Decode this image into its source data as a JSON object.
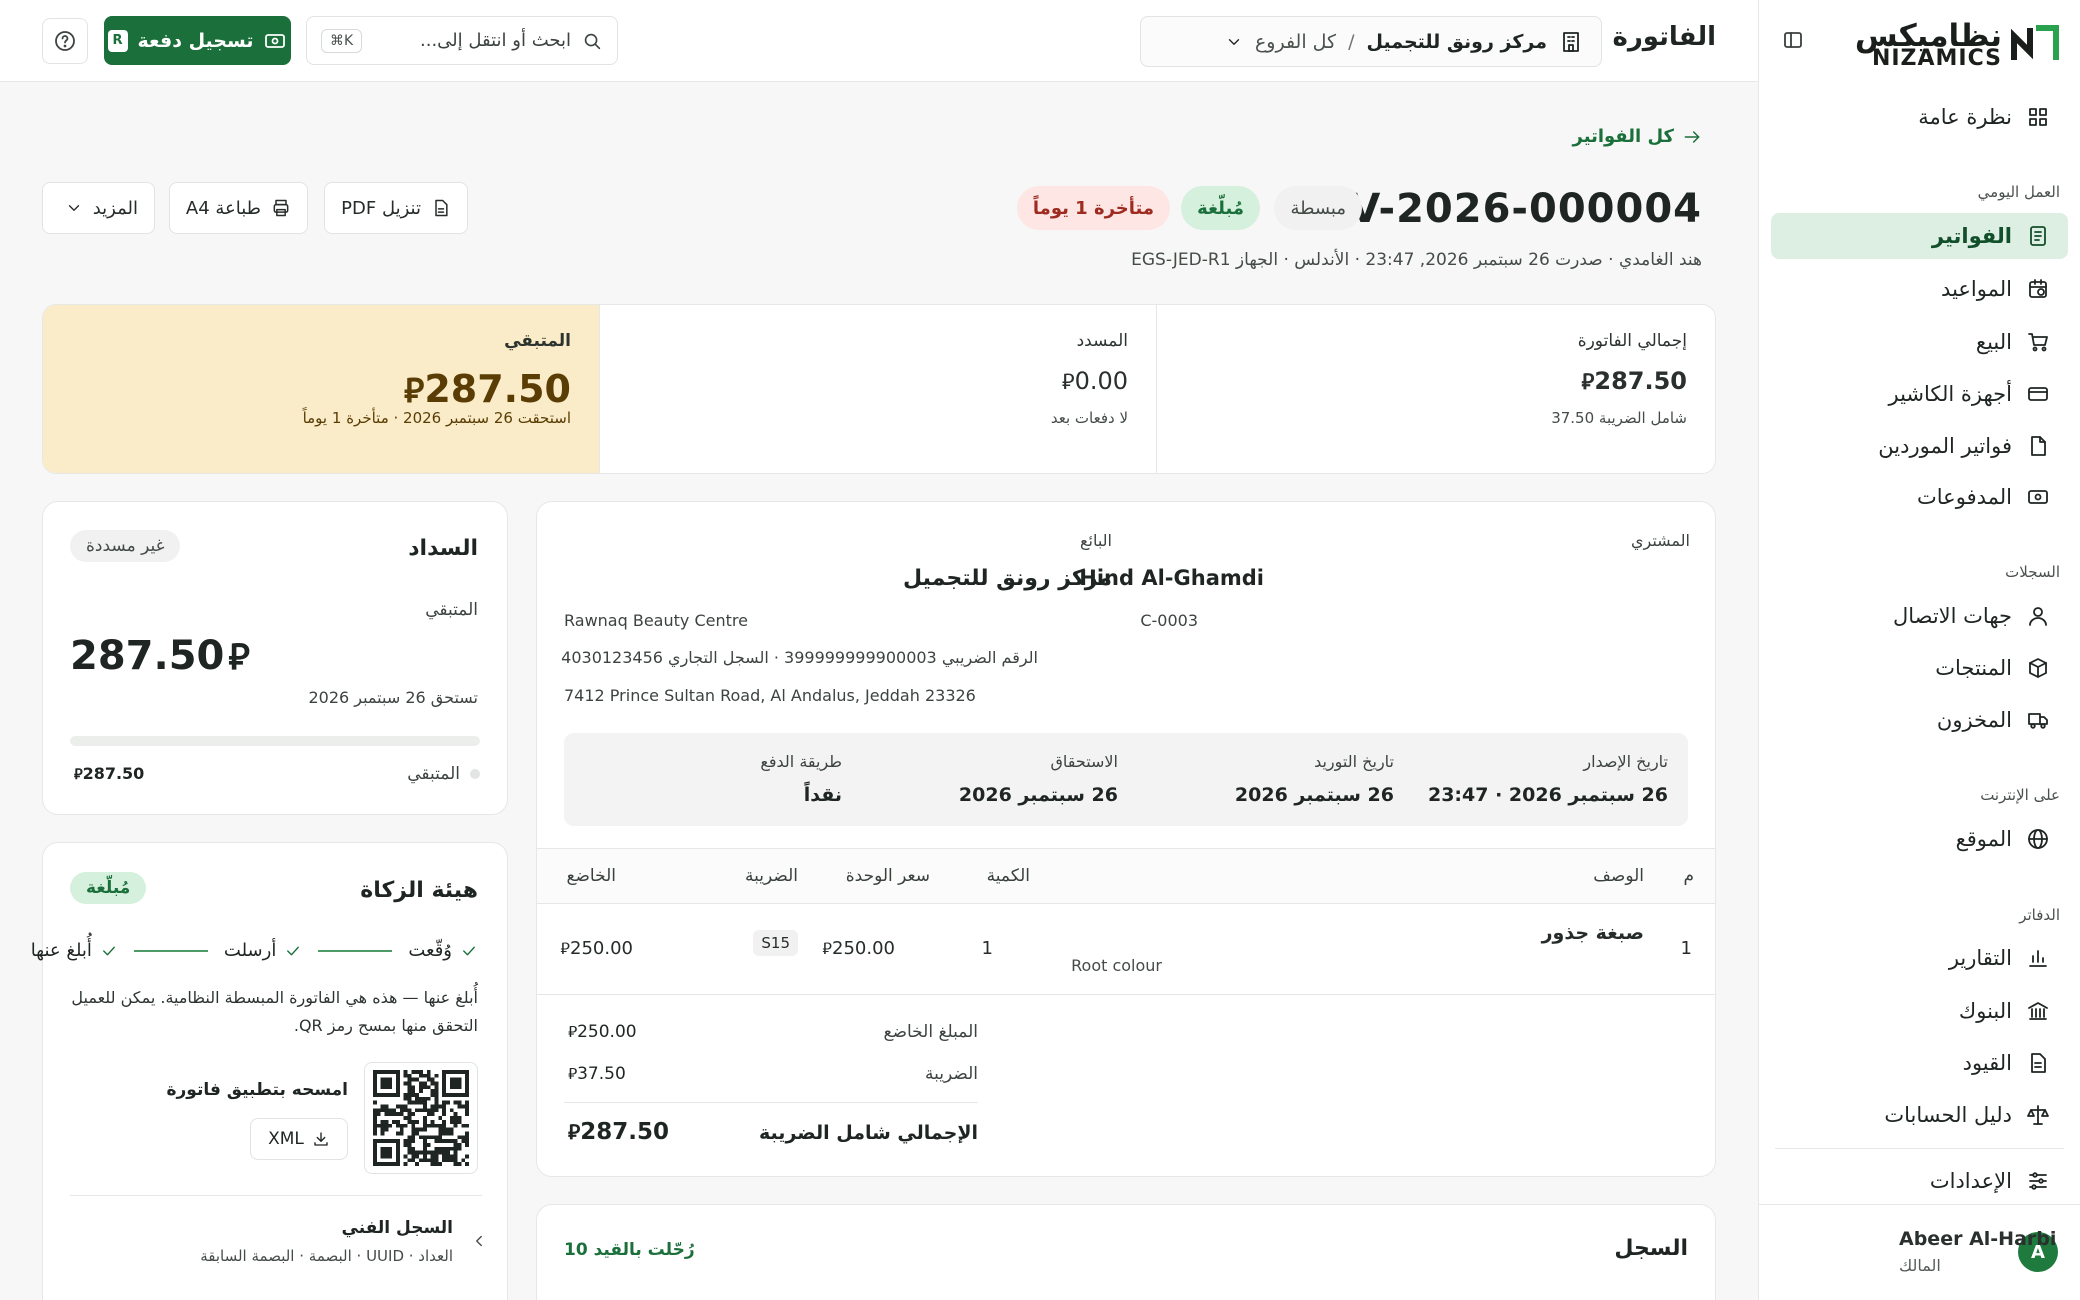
{
  "sidebar": {
    "logo_ar": "نظاميكس",
    "logo_en": "NIZAMICS",
    "items": [
      {
        "label": "نظرة عامة"
      },
      {
        "label": "الفواتير"
      },
      {
        "label": "المواعيد"
      },
      {
        "label": "البيع"
      },
      {
        "label": "أجهزة الكاشير"
      },
      {
        "label": "فواتير الموردين"
      },
      {
        "label": "المدفوعات"
      },
      {
        "label": "جهات الاتصال"
      },
      {
        "label": "المنتجات"
      },
      {
        "label": "المخزون"
      },
      {
        "label": "الموقع"
      },
      {
        "label": "التقارير"
      },
      {
        "label": "البنوك"
      },
      {
        "label": "القيود"
      },
      {
        "label": "دليل الحسابات"
      },
      {
        "label": "الإعدادات"
      }
    ],
    "sections": {
      "daily": "العمل اليومي",
      "records": "السجلات",
      "online": "على الإنترنت",
      "books": "الدفاتر"
    },
    "user": {
      "initial": "A",
      "name": "Abeer Al-Harbi",
      "role": "المالك"
    }
  },
  "topbar": {
    "title": "الفاتورة",
    "branch_name": "مركز رونق للتجميل",
    "branch_sep": "/",
    "branch_all": "كل الفروع",
    "search_placeholder": "ابحث أو انتقل إلى...",
    "search_kbd": "⌘K",
    "pay_label": "تسجيل دفعة",
    "pay_key": "R"
  },
  "header": {
    "back": "كل الفواتير",
    "invoice_no": "INV-2026-000004",
    "badge_type": "مبسطة",
    "badge_reported": "مُبلّغة",
    "badge_overdue": "متأخرة 1 يوماً",
    "meta": "هند الغامدي · صدرت 26 سبتمبر 2026, 23:47 · الأندلس · الجهاز EGS-JED-R1",
    "btn_pdf": "تنزيل PDF",
    "btn_print": "طباعة A4",
    "btn_more": "المزيد"
  },
  "summary": {
    "total_label": "إجمالي الفاتورة",
    "total_value": "287.50",
    "total_sub": "شامل الضريبة 37.50",
    "paid_label": "المسدد",
    "paid_value": "0.00",
    "paid_sub": "لا دفعات بعد",
    "remaining_label": "المتبقي",
    "remaining_value": "287.50",
    "remaining_sub": "استحقت 26 سبتمبر 2026 · متأخرة 1 يوماً"
  },
  "invoice": {
    "buyer_label": "المشتري",
    "buyer_name": "Hind Al-Ghamdi",
    "buyer_code": "C-0003",
    "seller_label": "البائع",
    "seller_name": "مركز رونق للتجميل",
    "seller_en": "Rawnaq Beauty Centre",
    "seller_ids": "الرقم الضريبي 399999999900003 · السجل التجاري 4030123456",
    "seller_addr": "7412 Prince Sultan Road, Al Andalus, Jeddah 23326",
    "dates": [
      {
        "label": "تاريخ الإصدار",
        "value": "26 سبتمبر 2026 · 23:47"
      },
      {
        "label": "تاريخ التوريد",
        "value": "26 سبتمبر 2026"
      },
      {
        "label": "الاستحقاق",
        "value": "26 سبتمبر 2026"
      },
      {
        "label": "طريقة الدفع",
        "value": "نقداً"
      }
    ],
    "columns": {
      "num": "م",
      "desc": "الوصف",
      "qty": "الكمية",
      "unit": "سعر الوحدة",
      "tax": "الضريبة",
      "taxable": "الخاضع"
    },
    "rows": [
      {
        "num": "1",
        "desc": "صبغة جذور",
        "desc_en": "Root colour",
        "qty": "1",
        "unit": "250.00",
        "tax": "S15",
        "taxable": "250.00"
      }
    ],
    "totals": {
      "taxable_label": "المبلغ الخاضع",
      "taxable": "250.00",
      "vat_label": "الضريبة",
      "vat": "37.50",
      "grand_label": "الإجمالي شامل الضريبة",
      "grand": "287.50"
    }
  },
  "payment": {
    "title": "السداد",
    "status": "غير مسددة",
    "remaining_label": "المتبقي",
    "remaining_value": "287.50",
    "due": "تستحق 26 سبتمبر 2026",
    "progress": 0,
    "legend_label": "المتبقي",
    "legend_value": "287.50"
  },
  "zatca": {
    "title": "هيئة الزكاة",
    "status": "مُبلّغة",
    "steps": [
      "وُقّعت",
      "أرسلت",
      "أُبلغ عنها"
    ],
    "note": "أُبلغ عنها — هذه هي الفاتورة المبسطة النظامية. يمكن للعميل التحقق منها بمسح رمز QR.",
    "scan_label": "امسحه بتطبيق فاتورة",
    "xml_label": "XML",
    "tech_title": "السجل الفني",
    "tech_sub": "العداد · UUID · البصمة · البصمة السابقة"
  },
  "log": {
    "title": "السجل",
    "posted": "رُحّلت بالقيد 10"
  },
  "currency_symbol": "⃁",
  "colors": {
    "brand": "#1a6f3a",
    "active_bg": "#dcefe2",
    "overdue_bg": "#fde6e4",
    "remaining_bg": "#faecc8"
  }
}
